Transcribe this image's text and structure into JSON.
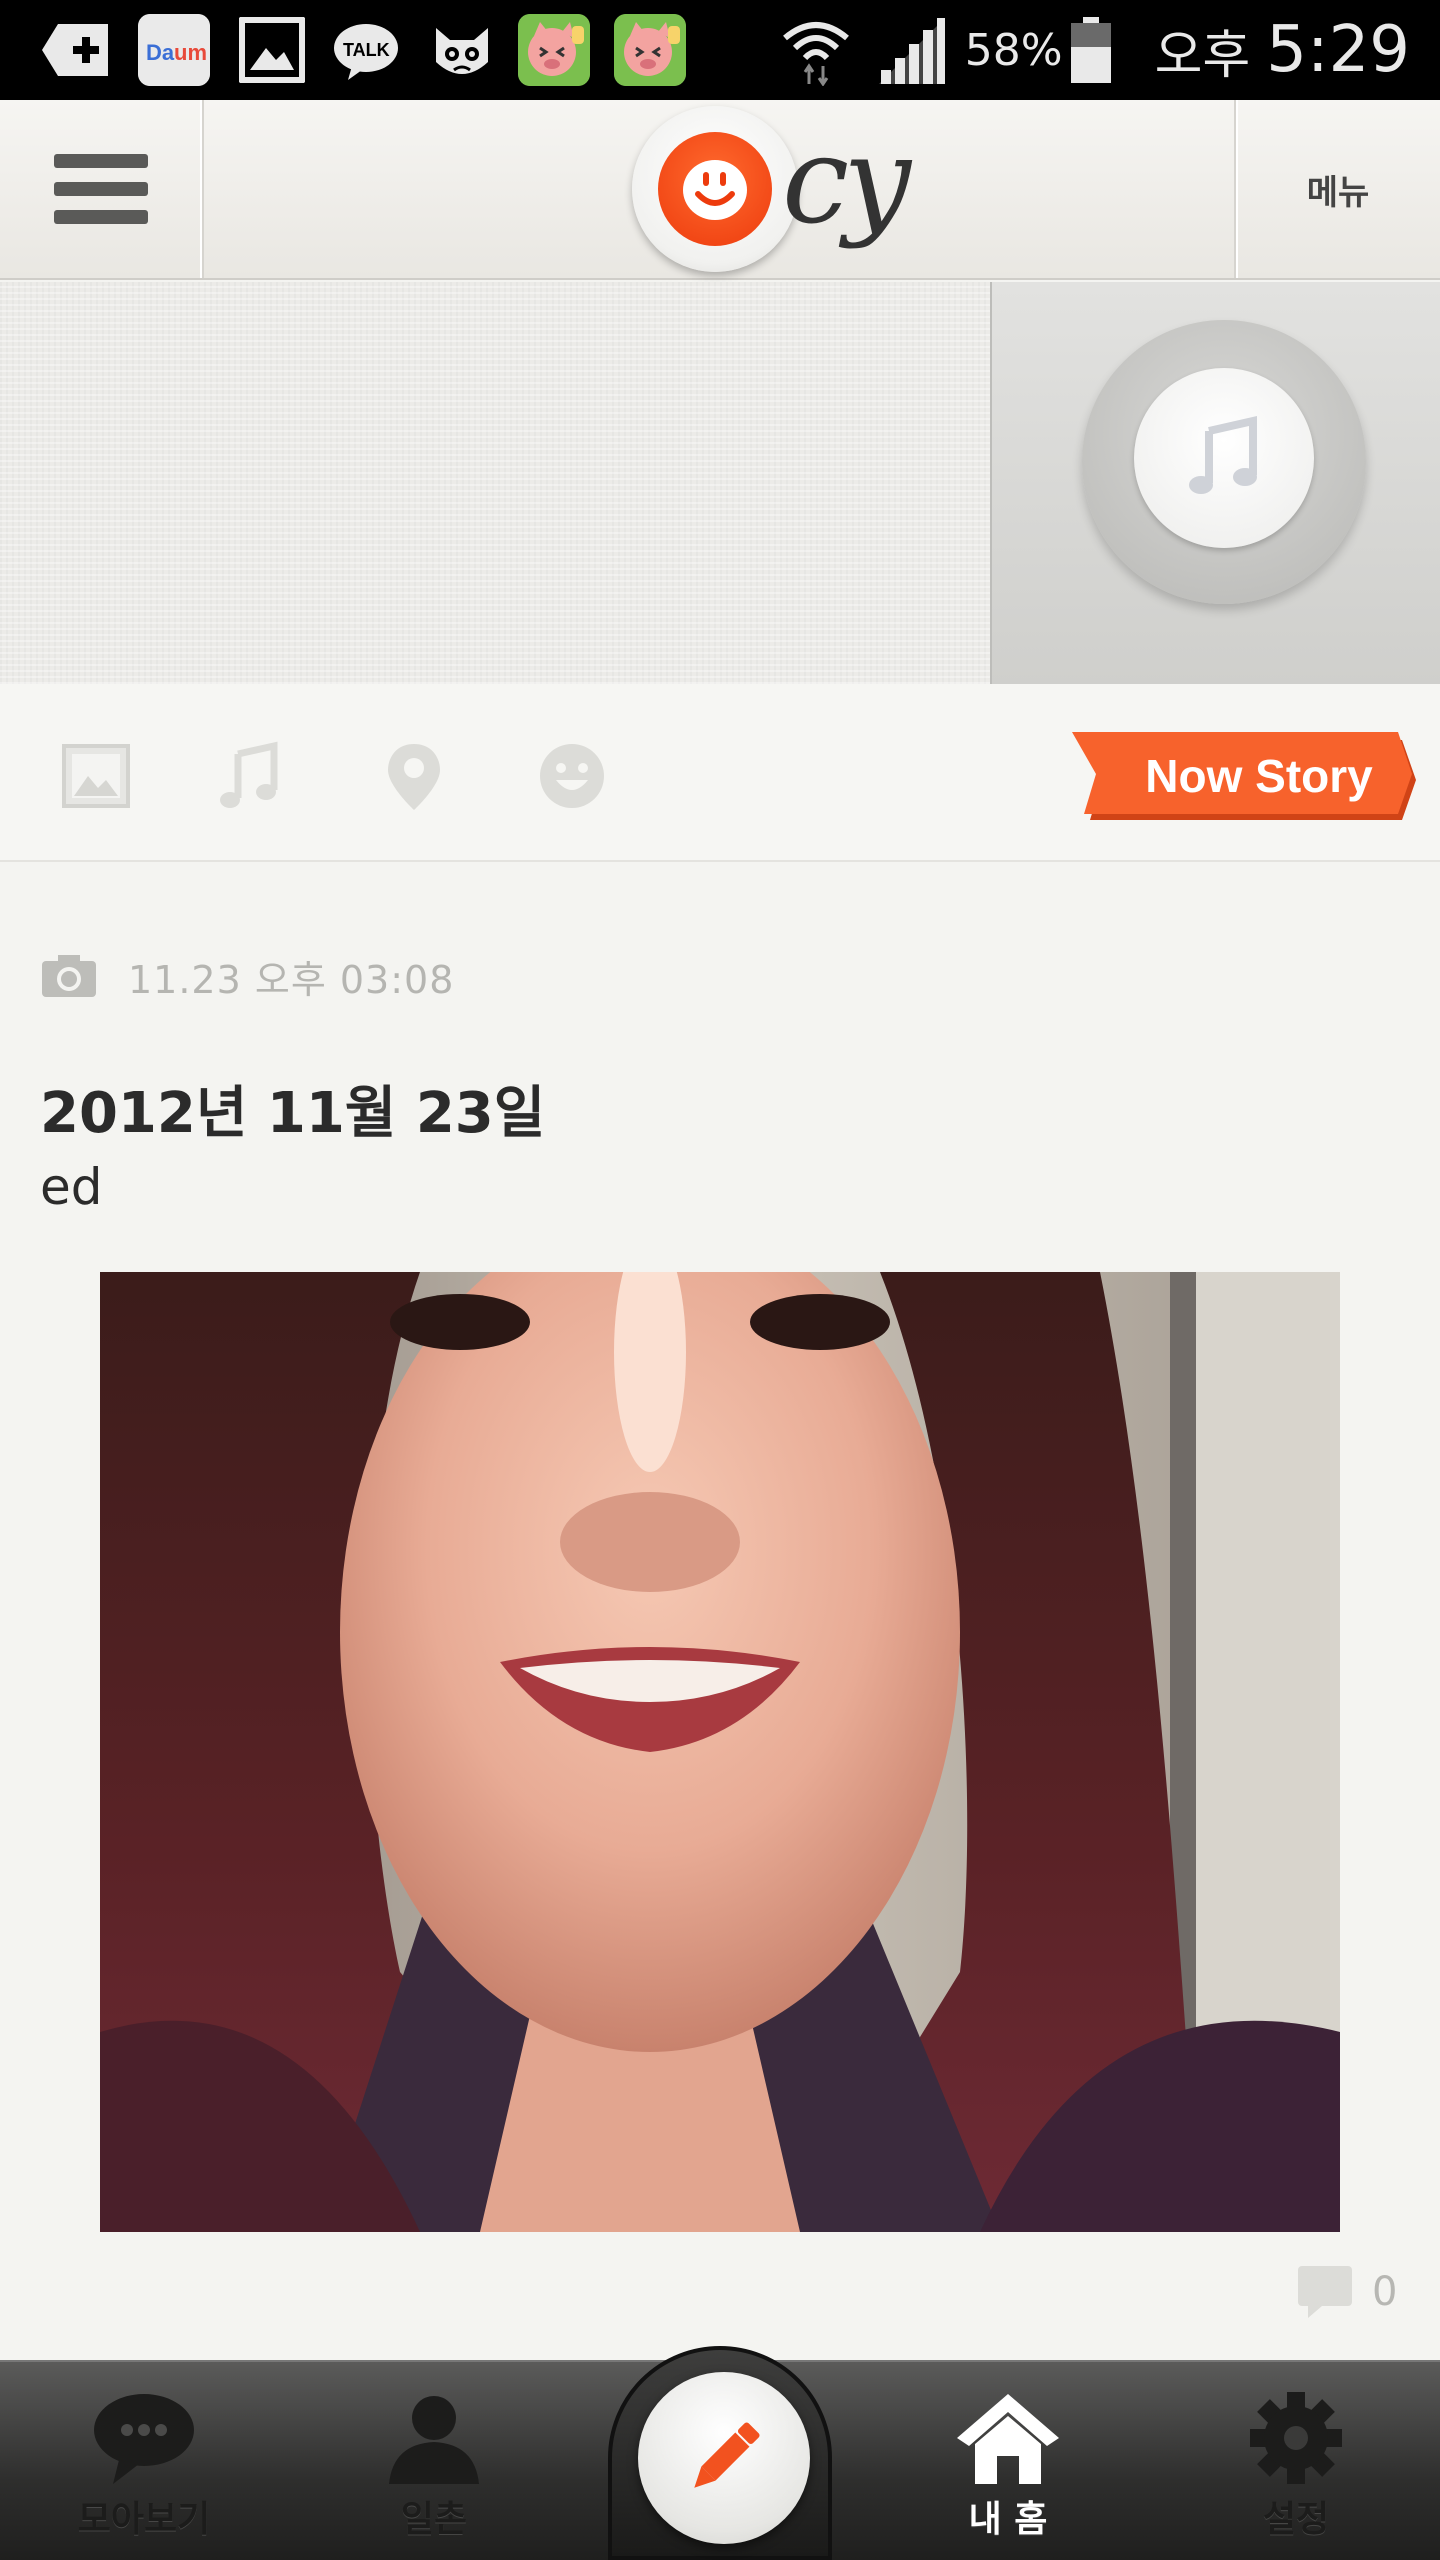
{
  "status_bar": {
    "battery_percent": "58%",
    "am_pm": "오후",
    "time": "5:29",
    "notification_icons": [
      "add-icon",
      "daum-icon",
      "gallery-icon",
      "kakaotalk-icon",
      "cat-game-icon",
      "pig-game-icon",
      "pig-game-icon"
    ]
  },
  "header": {
    "logo_text": "cy",
    "menu_label": "메뉴"
  },
  "story_toolbar": {
    "icons": [
      "image-icon",
      "music-note-icon",
      "location-pin-icon",
      "smiley-icon"
    ],
    "now_story_label": "Now Story"
  },
  "post": {
    "timestamp": "11.23 오후 03:08",
    "title": "2012년 11월 23일",
    "body": "ed",
    "comment_count": "0"
  },
  "bottom_nav": {
    "items": [
      {
        "label": "모아보기",
        "icon": "chat-bubble-icon"
      },
      {
        "label": "일촌",
        "icon": "person-icon"
      },
      {
        "label": "",
        "icon": "pencil-icon"
      },
      {
        "label": "내 홈",
        "icon": "home-icon"
      },
      {
        "label": "설정",
        "icon": "gear-icon"
      }
    ]
  },
  "colors": {
    "accent": "#f2521f",
    "status_bar_bg": "#000000",
    "page_bg": "#f4f4f1"
  }
}
